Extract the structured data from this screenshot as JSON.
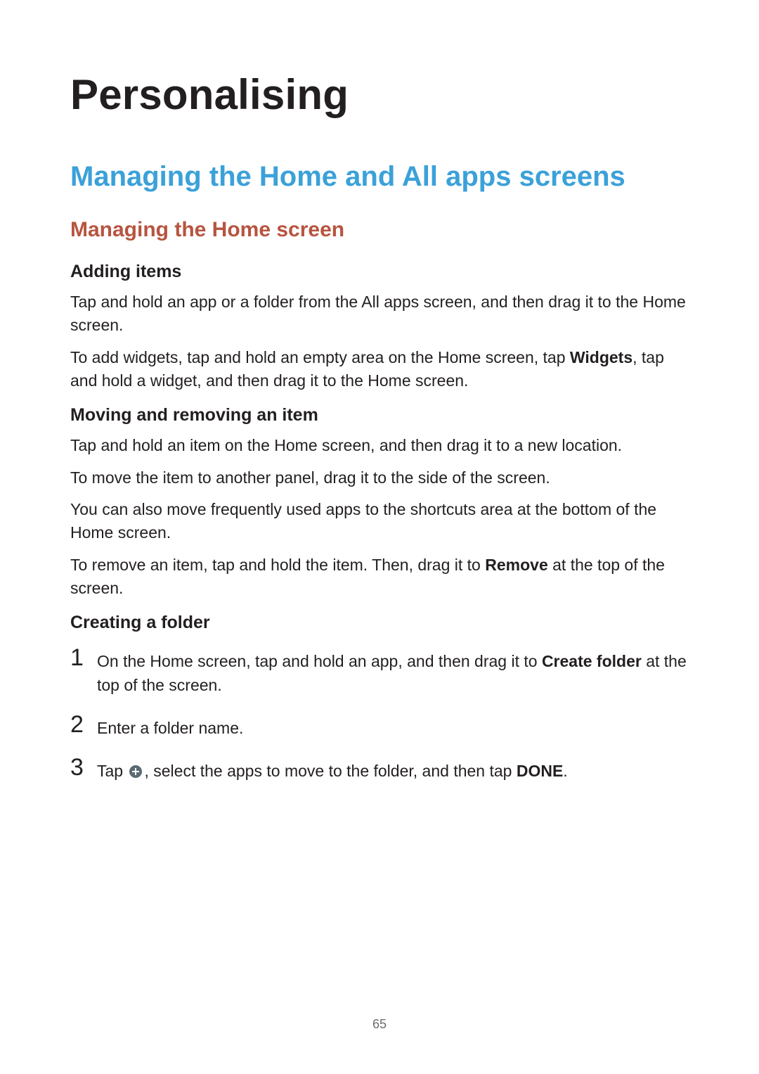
{
  "page_number": "65",
  "title": "Personalising",
  "section_h2": "Managing the Home and All apps screens",
  "section_h3": "Managing the Home screen",
  "adding_items": {
    "heading": "Adding items",
    "p1": "Tap and hold an app or a folder from the All apps screen, and then drag it to the Home screen.",
    "p2_pre": "To add widgets, tap and hold an empty area on the Home screen, tap ",
    "p2_bold": "Widgets",
    "p2_post": ", tap and hold a widget, and then drag it to the Home screen."
  },
  "moving_removing": {
    "heading": "Moving and removing an item",
    "p1": "Tap and hold an item on the Home screen, and then drag it to a new location.",
    "p2": "To move the item to another panel, drag it to the side of the screen.",
    "p3": "You can also move frequently used apps to the shortcuts area at the bottom of the Home screen.",
    "p4_pre": "To remove an item, tap and hold the item. Then, drag it to ",
    "p4_bold": "Remove",
    "p4_post": " at the top of the screen."
  },
  "creating_folder": {
    "heading": "Creating a folder",
    "step1": {
      "num": "1",
      "pre": "On the Home screen, tap and hold an app, and then drag it to ",
      "bold": "Create folder",
      "post": " at the top of the screen."
    },
    "step2": {
      "num": "2",
      "text": "Enter a folder name."
    },
    "step3": {
      "num": "3",
      "pre": "Tap ",
      "post_pre": ", select the apps to move to the folder, and then tap ",
      "bold": "DONE",
      "post_post": "."
    }
  },
  "icons": {
    "plus_color": "#5b6b73"
  }
}
